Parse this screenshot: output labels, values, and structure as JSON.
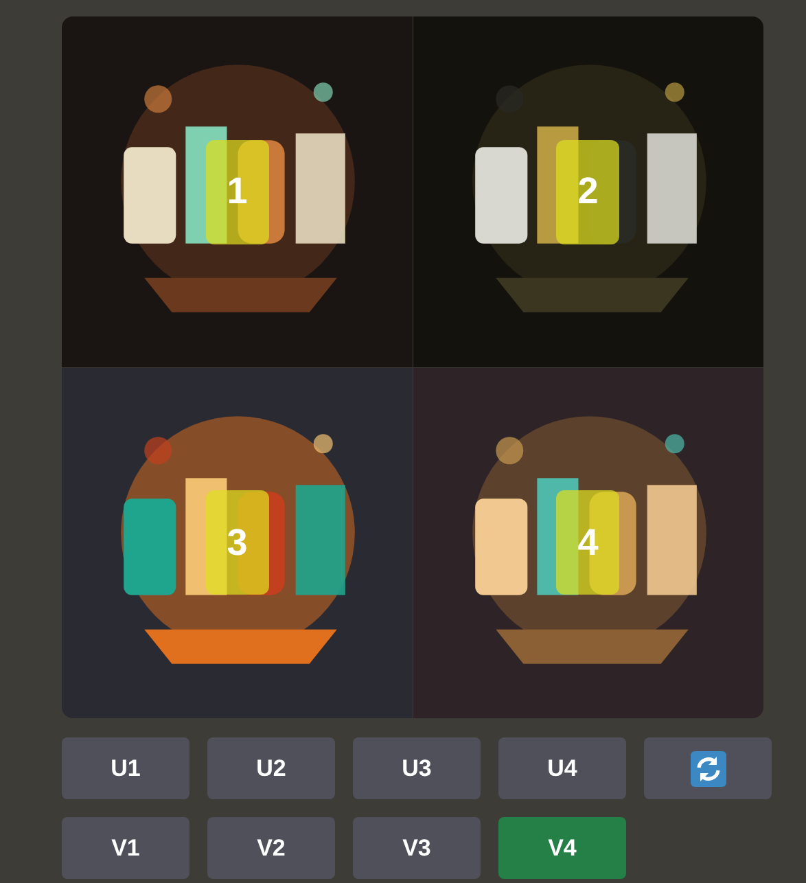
{
  "images": [
    {
      "kind": "picture",
      "badge": "1"
    },
    {
      "kind": "picture",
      "badge": "2"
    },
    {
      "kind": "picture",
      "badge": "3"
    },
    {
      "kind": "picture",
      "badge": "4"
    }
  ],
  "button_rows": [
    [
      {
        "kind": "text",
        "label": "U1",
        "selected": false
      },
      {
        "kind": "text",
        "label": "U2",
        "selected": false
      },
      {
        "kind": "text",
        "label": "U3",
        "selected": false
      },
      {
        "kind": "text",
        "label": "U4",
        "selected": false
      },
      {
        "kind": "refresh",
        "selected": false
      }
    ],
    [
      {
        "kind": "text",
        "label": "V1",
        "selected": false
      },
      {
        "kind": "text",
        "label": "V2",
        "selected": false
      },
      {
        "kind": "text",
        "label": "V3",
        "selected": false
      },
      {
        "kind": "text",
        "label": "V4",
        "selected": true
      }
    ]
  ]
}
